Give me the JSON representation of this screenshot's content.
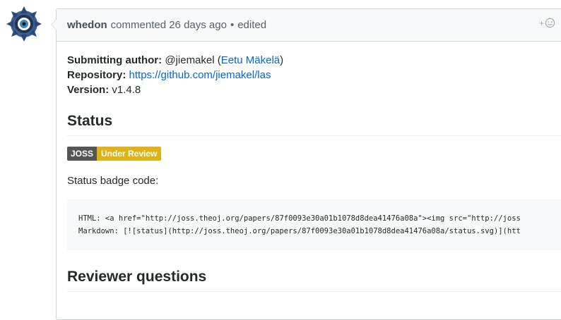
{
  "comment": {
    "author": "whedon",
    "action": "commented",
    "time": "26 days ago",
    "separator": "•",
    "edited": "edited",
    "reaction_plus": "+",
    "reaction_icon": "smiley-icon"
  },
  "meta": {
    "submitting_author_label": "Submitting author:",
    "submitting_author_handle": "@jiemakel",
    "submitting_author_name_open": "(",
    "submitting_author_name": "Eetu Mäkelä",
    "submitting_author_name_close": ")",
    "repository_label": "Repository:",
    "repository_url": "https://github.com/jiemakel/las",
    "version_label": "Version:",
    "version_value": "v1.4.8"
  },
  "status": {
    "heading": "Status",
    "badge_left": "JOSS",
    "badge_right": "Under Review",
    "badge_code_caption": "Status badge code:",
    "code_html_line": "HTML: <a href=\"http://joss.theoj.org/papers/87f0093e30a01b1078d8dea41476a08a\"><img src=\"http://joss",
    "code_markdown_line": "Markdown: [![status](http://joss.theoj.org/papers/87f0093e30a01b1078d8dea41476a08a/status.svg)](htt"
  },
  "reviewer": {
    "heading": "Reviewer questions"
  },
  "colors": {
    "link": "#0366d6",
    "badge_left_bg": "#555555",
    "badge_right_bg": "#dfb317"
  }
}
